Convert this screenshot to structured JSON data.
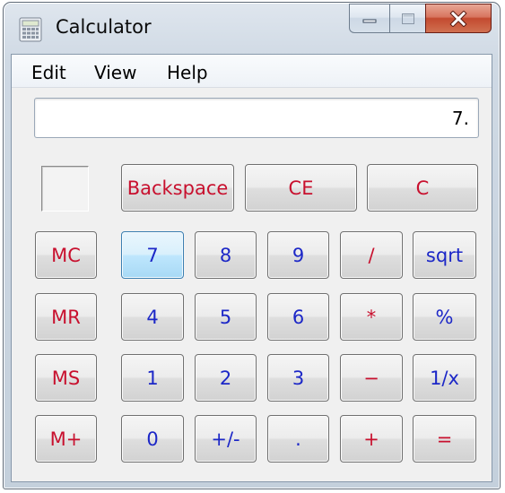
{
  "window": {
    "title": "Calculator",
    "controls": {
      "minimize_icon": "minimize-icon",
      "maximize_icon": "maximize-icon",
      "close_icon": "close-icon"
    }
  },
  "menu": [
    "Edit",
    "View",
    "Help"
  ],
  "display": {
    "value": "7."
  },
  "buttons": {
    "backspace": "Backspace",
    "ce": "CE",
    "c": "C",
    "mc": "MC",
    "mr": "MR",
    "ms": "MS",
    "mplus": "M+",
    "d7": "7",
    "d8": "8",
    "d9": "9",
    "divide": "/",
    "sqrt": "sqrt",
    "d4": "4",
    "d5": "5",
    "d6": "6",
    "multiply": "*",
    "percent": "%",
    "d1": "1",
    "d2": "2",
    "d3": "3",
    "subtract": "−",
    "reciprocal": "1/x",
    "d0": "0",
    "sign": "+/-",
    "decimal": ".",
    "add": "+",
    "equals": "="
  },
  "colors": {
    "memory_ops": "#c8102e",
    "digits": "#1c27c7",
    "highlight": "#bee6fd"
  }
}
